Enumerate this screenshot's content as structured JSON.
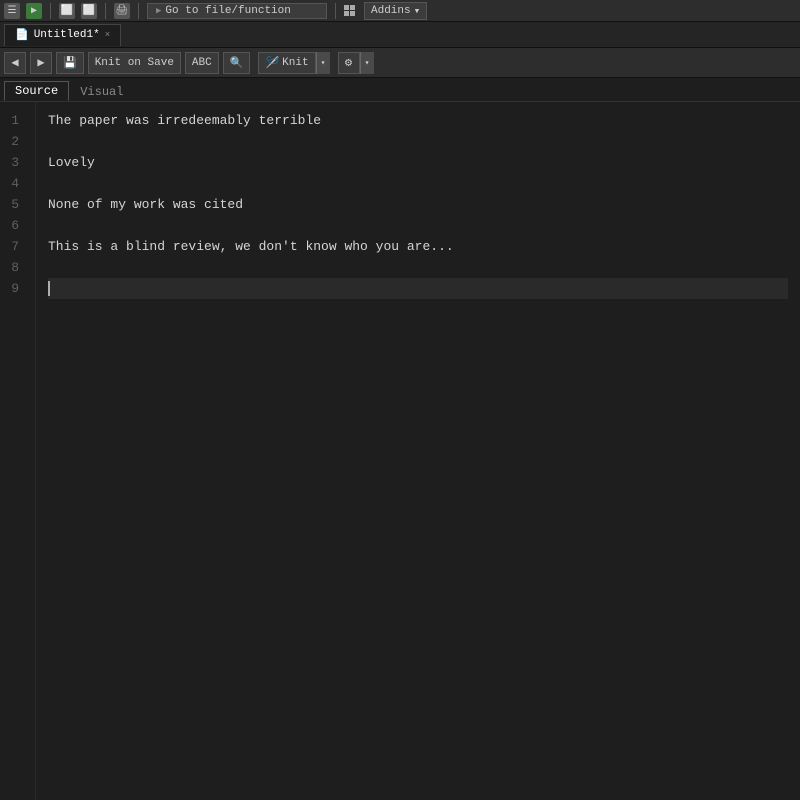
{
  "window": {
    "title": "Untitled1*",
    "tab_close": "×"
  },
  "menubar": {
    "go_to_placeholder": "Go to file/function",
    "addins_label": "Addins",
    "addins_arrow": "▾"
  },
  "toolbar": {
    "back_label": "◀",
    "forward_label": "▶",
    "save_icon": "💾",
    "knit_on_save_label": "Knit on Save",
    "abc_label": "ABC",
    "search_icon": "🔍",
    "knit_label": "Knit",
    "knit_arrow": "▾",
    "gear_label": "⚙",
    "gear_arrow": "▾"
  },
  "view_tabs": {
    "source_label": "Source",
    "visual_label": "Visual"
  },
  "editor": {
    "lines": [
      {
        "number": "1",
        "content": "The paper was irredeemably terrible",
        "active": false
      },
      {
        "number": "2",
        "content": "",
        "active": false
      },
      {
        "number": "3",
        "content": "Lovely",
        "active": false
      },
      {
        "number": "4",
        "content": "",
        "active": false
      },
      {
        "number": "5",
        "content": "None of my work was cited",
        "active": false
      },
      {
        "number": "6",
        "content": "",
        "active": false
      },
      {
        "number": "7",
        "content": "This is a blind review, we don't know who you are...",
        "active": false
      },
      {
        "number": "8",
        "content": "",
        "active": false
      },
      {
        "number": "9",
        "content": "",
        "active": true
      }
    ]
  },
  "colors": {
    "bg_dark": "#1a1a1a",
    "bg_editor": "#1e1e1e",
    "bg_toolbar": "#2d2d2d",
    "text_code": "#d4d4d4",
    "line_number": "#606060"
  }
}
